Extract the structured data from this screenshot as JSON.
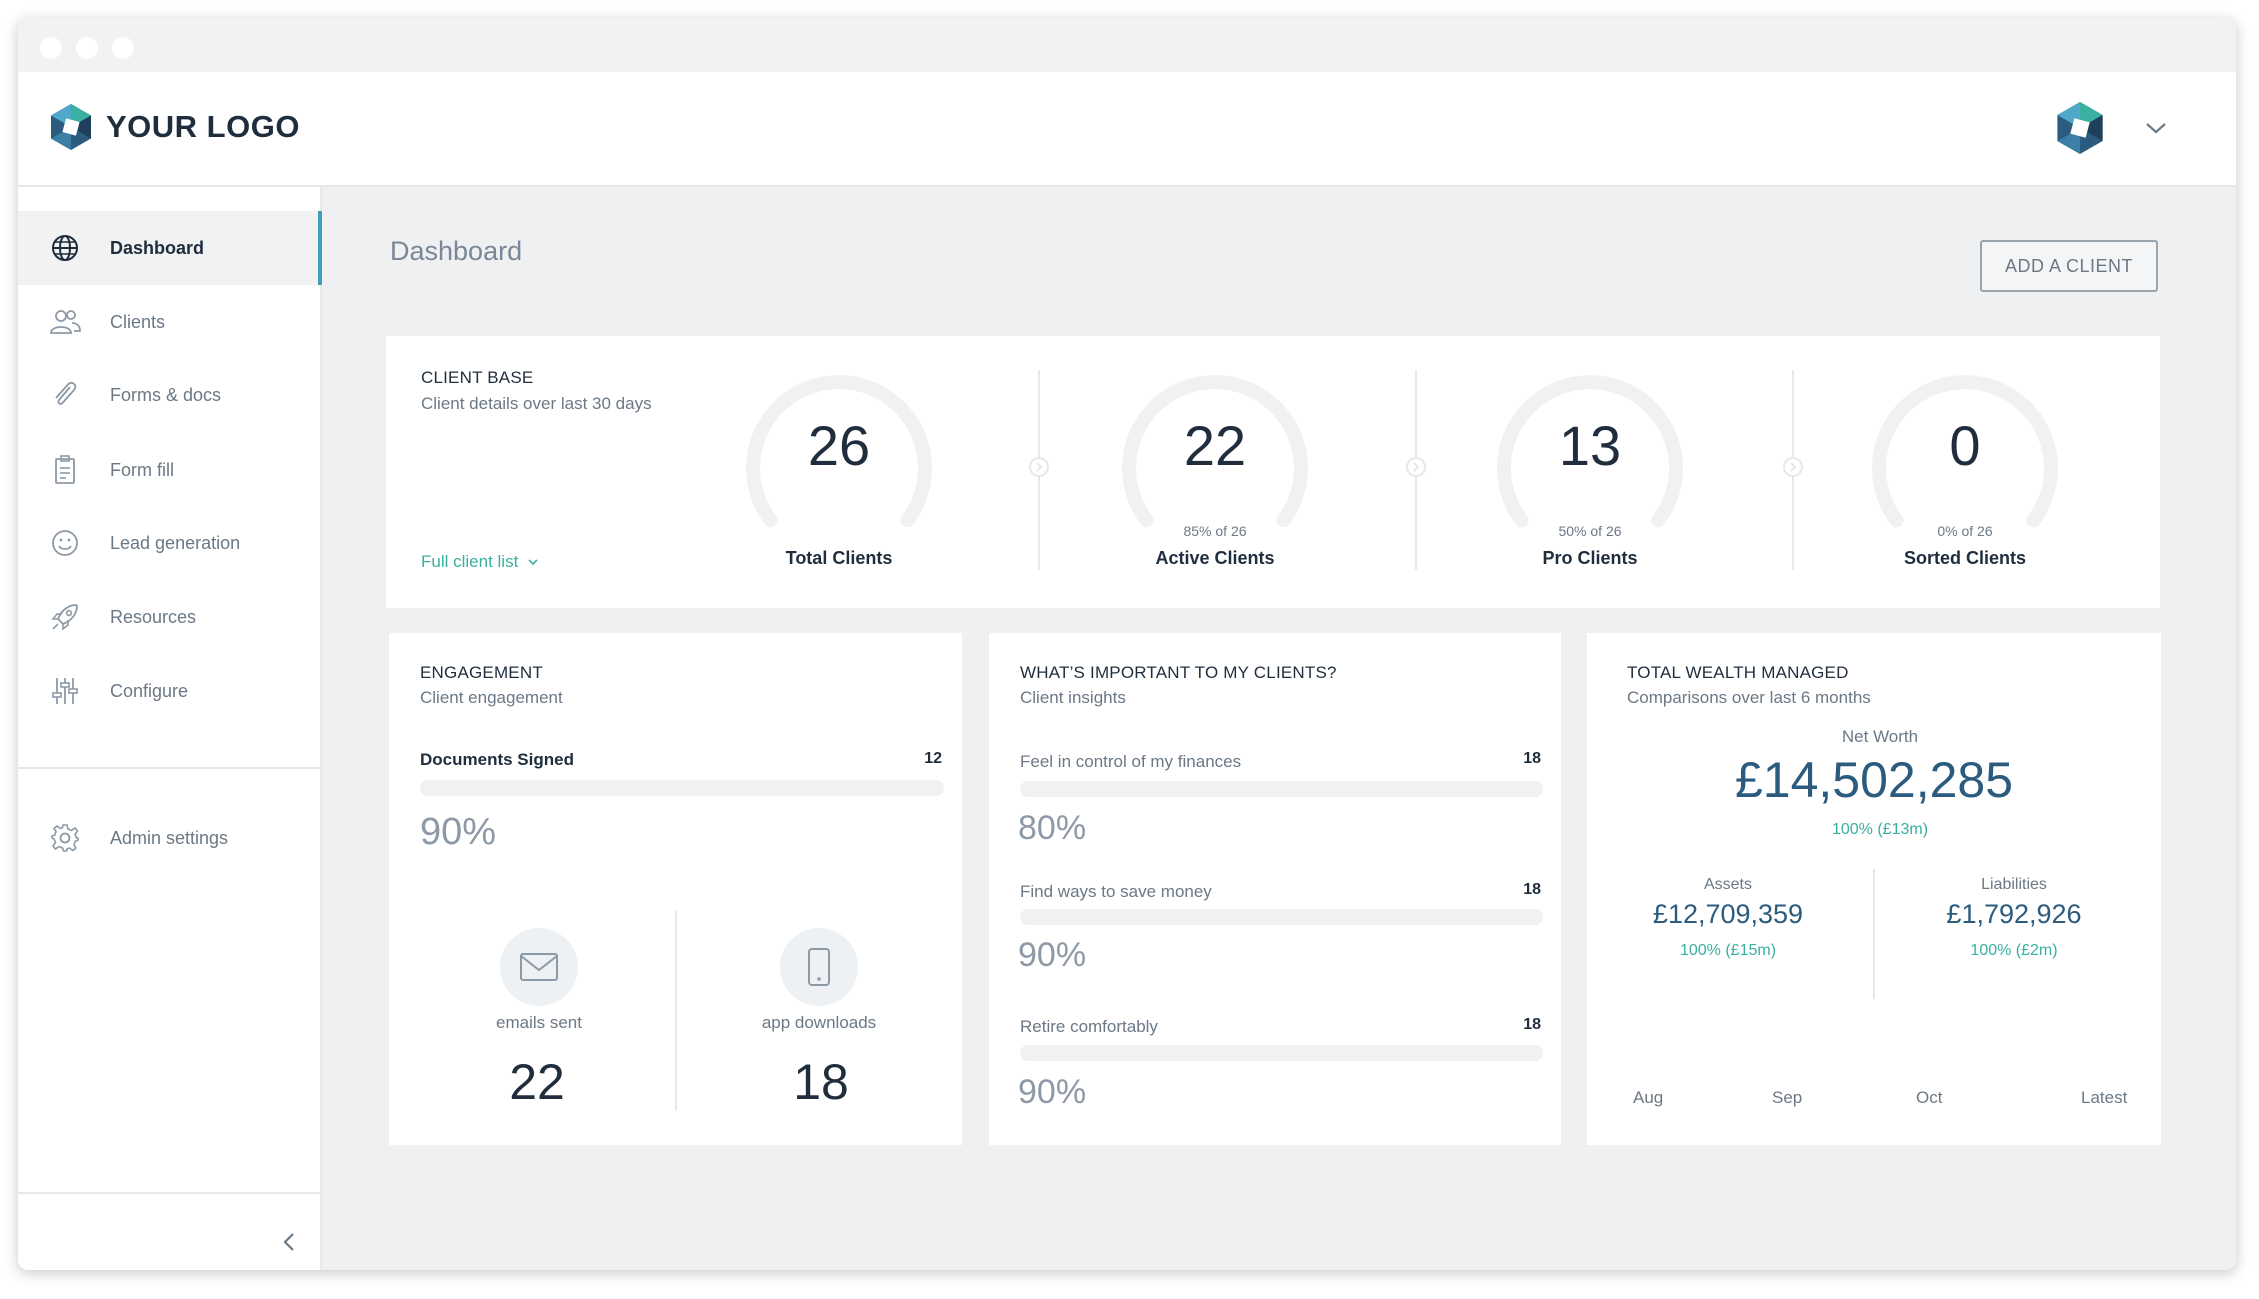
{
  "brand": {
    "logo_text": "YOUR LOGO",
    "primary": "#2b5b7e",
    "accent_teal": "#3ab0a0",
    "active_border": "#3e9fbd"
  },
  "sidebar": {
    "items": [
      {
        "label": "Dashboard",
        "icon": "globe-icon",
        "active": true
      },
      {
        "label": "Clients",
        "icon": "users-icon"
      },
      {
        "label": "Forms & docs",
        "icon": "paperclip-icon"
      },
      {
        "label": "Form fill",
        "icon": "clipboard-icon"
      },
      {
        "label": "Lead generation",
        "icon": "smiley-icon"
      },
      {
        "label": "Resources",
        "icon": "rocket-icon"
      },
      {
        "label": "Configure",
        "icon": "sliders-icon"
      }
    ],
    "admin": {
      "label": "Admin settings",
      "icon": "gear-icon"
    },
    "collapse_icon": "chevron-left-icon"
  },
  "header": {
    "user_icon": "avatar-logo-icon",
    "menu_icon": "chevron-down-icon"
  },
  "page": {
    "title": "Dashboard",
    "add_button": "ADD A CLIENT"
  },
  "client_base": {
    "title": "CLIENT BASE",
    "subtitle": "Client details over last 30 days",
    "link": "Full client list",
    "gauges": [
      {
        "value": "26",
        "sub": "",
        "label": "Total Clients"
      },
      {
        "value": "22",
        "sub": "85% of 26",
        "label": "Active Clients"
      },
      {
        "value": "13",
        "sub": "50% of 26",
        "label": "Pro Clients"
      },
      {
        "value": "0",
        "sub": "0% of 26",
        "label": "Sorted Clients"
      }
    ]
  },
  "engagement": {
    "title": "ENGAGEMENT",
    "subtitle": "Client engagement",
    "docs_label": "Documents Signed",
    "docs_count": "12",
    "docs_pct": "90%",
    "emails_label": "emails sent",
    "emails_value": "22",
    "emails_icon": "envelope-icon",
    "app_label": "app downloads",
    "app_value": "18",
    "app_icon": "phone-icon"
  },
  "insights": {
    "title": "WHAT’S IMPORTANT TO MY CLIENTS?",
    "subtitle": "Client insights",
    "rows": [
      {
        "label": "Feel in control of my finances",
        "count": "18",
        "pct": "80%"
      },
      {
        "label": "Find ways to save money",
        "count": "18",
        "pct": "90%"
      },
      {
        "label": "Retire comfortably",
        "count": "18",
        "pct": "90%"
      }
    ]
  },
  "wealth": {
    "title": "TOTAL WEALTH MANAGED",
    "subtitle": "Comparisons over last 6 months",
    "net_worth_label": "Net Worth",
    "net_worth_value": "£14,502,285",
    "net_worth_change": "100% (£13m)",
    "assets_label": "Assets",
    "assets_value": "£12,709,359",
    "assets_change": "100% (£15m)",
    "liabilities_label": "Liabilities",
    "liabilities_value": "£1,792,926",
    "liabilities_change": "100% (£2m)",
    "months": [
      "Aug",
      "Sep",
      "Oct",
      "Latest"
    ]
  }
}
